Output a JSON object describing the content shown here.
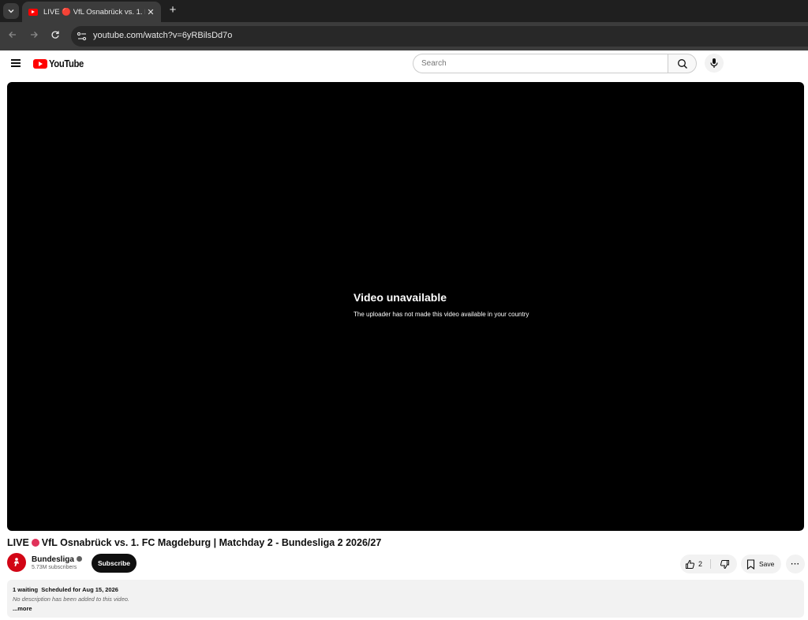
{
  "browser": {
    "tab_title": "LIVE 🔴 VfL Osnabrück vs. 1. FC",
    "tab_close": "✕",
    "new_tab": "+",
    "url": "youtube.com/watch?v=6yRBilsDd7o"
  },
  "header": {
    "logo_text": "YouTube",
    "search_placeholder": "Search"
  },
  "player": {
    "error_title": "Video unavailable",
    "error_message": "The uploader has not made this video available in your country"
  },
  "video": {
    "title_prefix": "LIVE",
    "title_rest": "VfL Osnabrück vs. 1. FC Magdeburg | Matchday 2 - Bundesliga 2 2026/27",
    "live_dot_color": "#e0325a"
  },
  "channel": {
    "name": "Bundesliga",
    "subscribers": "5.73M subscribers",
    "subscribe_label": "Subscribe"
  },
  "actions": {
    "like_count": "2",
    "save_label": "Save",
    "more_label": "···"
  },
  "description": {
    "waiting": "1 waiting",
    "scheduled": "Scheduled for Aug 15, 2026",
    "text": "No description has been added to this video.",
    "more": "...more"
  },
  "colors": {
    "brand_red": "#ff0000",
    "subscribe_bg": "#0f0f0f"
  }
}
